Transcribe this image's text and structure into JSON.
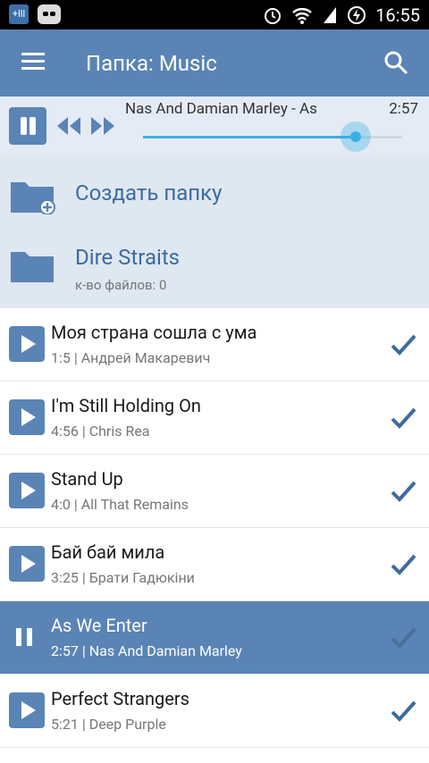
{
  "status_bar": {
    "time": "16:55",
    "left_icon_text": "+lll"
  },
  "app_bar": {
    "title": "Папка: Music"
  },
  "player": {
    "now_playing": "Nas And Damian Marley - As",
    "time": "2:57",
    "progress": 0.82
  },
  "folders": [
    {
      "label": "Создать папку",
      "sub": ""
    },
    {
      "label": "Dire Straits",
      "sub": "к-во файлов: 0"
    }
  ],
  "tracks": [
    {
      "title": "Моя страна сошла с ума",
      "meta": "1:5 | Андрей Макаревич",
      "active": false
    },
    {
      "title": "I'm Still Holding On",
      "meta": "4:56 | Chris Rea",
      "active": false
    },
    {
      "title": "Stand Up",
      "meta": "4:0 | All That Remains",
      "active": false
    },
    {
      "title": "Бай бай мила",
      "meta": "3:25 | Брати Гадюкіни",
      "active": false
    },
    {
      "title": "As We Enter",
      "meta": "2:57 | Nas And Damian Marley",
      "active": true
    },
    {
      "title": "Perfect Strangers",
      "meta": "5:21 | Deep Purple",
      "active": false
    }
  ],
  "colors": {
    "accent": "#5a84b5",
    "progress": "#3ab0e2",
    "folder_bg": "#dfe7f1"
  }
}
